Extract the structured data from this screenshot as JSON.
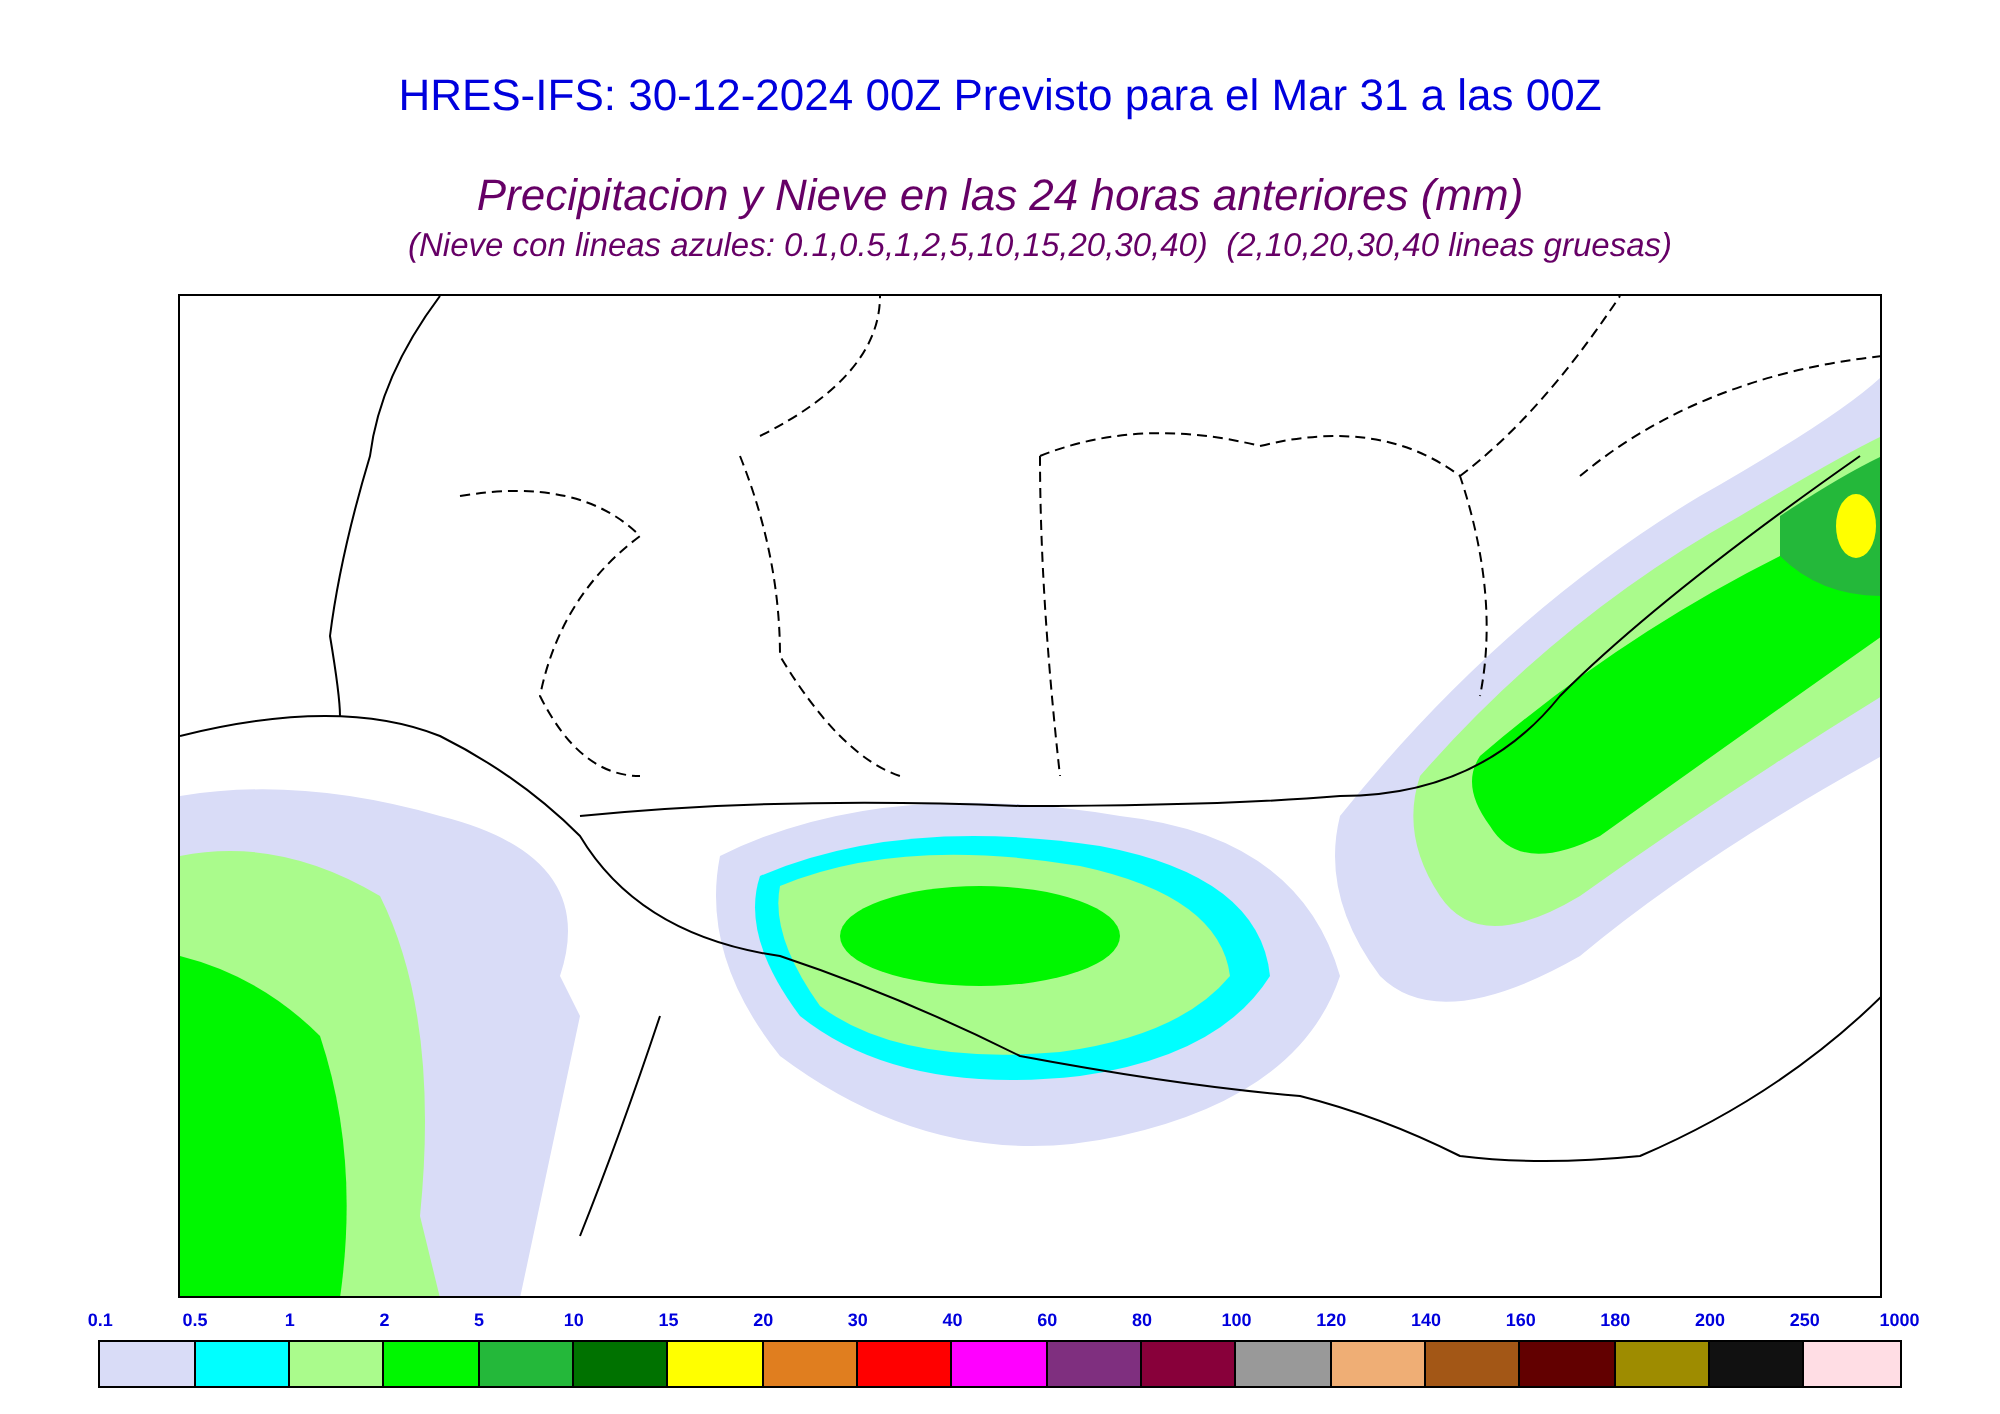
{
  "title": "HRES-IFS: 30-12-2024 00Z Previsto para el Mar 31 a las 00Z",
  "subtitle": "Precipitacion y Nieve en las 24 horas anteriores (mm)",
  "note": "(Nieve con lineas azules: 0.1,0.5,1,2,5,10,15,20,30,40)  (2,10,20,30,40 lineas gruesas)",
  "legend": {
    "labels": [
      "0.1",
      "0.5",
      "1",
      "2",
      "5",
      "10",
      "15",
      "20",
      "30",
      "40",
      "60",
      "80",
      "100",
      "120",
      "140",
      "160",
      "180",
      "200",
      "250",
      "1000"
    ],
    "swatches": [
      {
        "color": "#d9dcf7"
      },
      {
        "color": "#00ffff"
      },
      {
        "color": "#aafb8c"
      },
      {
        "color": "#00f700"
      },
      {
        "color": "#24b83a"
      },
      {
        "color": "#007200"
      },
      {
        "color": "#ffff00"
      },
      {
        "color": "#e07e1f"
      },
      {
        "color": "#ff0000"
      },
      {
        "color": "#ff00ff"
      },
      {
        "color": "#7f2f7f"
      },
      {
        "color": "#88003a"
      },
      {
        "color": "#999999"
      },
      {
        "color": "#efae75"
      },
      {
        "color": "#a35716"
      },
      {
        "color": "#620000"
      },
      {
        "color": "#9e8c00"
      },
      {
        "color": "#111111"
      },
      {
        "color": "#ffdde4"
      }
    ]
  }
}
